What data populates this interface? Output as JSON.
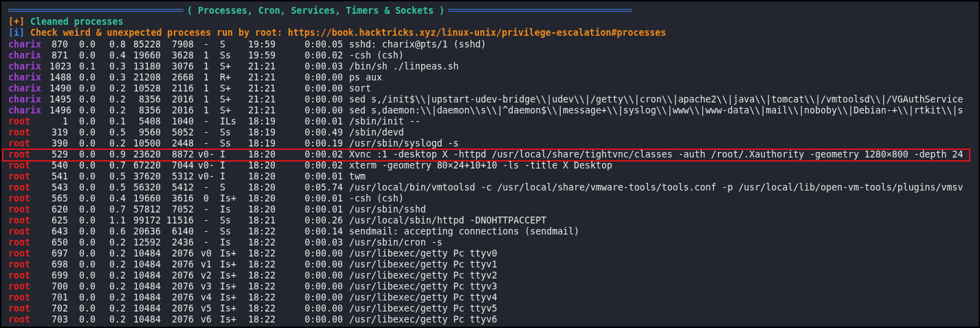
{
  "section_title": "( Processes, Cron, Services, Timers & Sockets )",
  "messages": [
    {
      "marker": "[+]",
      "kind": "ok",
      "text": "Cleaned processes"
    },
    {
      "marker": "[i]",
      "kind": "info",
      "text": "Check weird & unexpected proceses run by root: https://book.hacktricks.xyz/linux-unix/privilege-escalation#processes"
    }
  ],
  "rows": [
    {
      "user": "charix",
      "color": "#a244d4",
      "pid": "870",
      "cpu": "0.0",
      "mem": "0.8",
      "vsz": "85228",
      "rss": "7908",
      "tt": "-",
      "stat": "S",
      "started": "19:59",
      "time": "0:00.05",
      "command": "sshd: charix@pts/1 (sshd)",
      "highlighted": false
    },
    {
      "user": "charix",
      "color": "#a244d4",
      "pid": "871",
      "cpu": "0.0",
      "mem": "0.4",
      "vsz": "19660",
      "rss": "3628",
      "tt": "1",
      "stat": "Ss",
      "started": "19:59",
      "time": "0:00.02",
      "command": "-csh (csh)",
      "highlighted": false
    },
    {
      "user": "charix",
      "color": "#a244d4",
      "pid": "1023",
      "cpu": "0.1",
      "mem": "0.3",
      "vsz": "13180",
      "rss": "3076",
      "tt": "1",
      "stat": "S+",
      "started": "21:21",
      "time": "0:00.03",
      "command": "/bin/sh ./linpeas.sh",
      "highlighted": false
    },
    {
      "user": "charix",
      "color": "#a244d4",
      "pid": "1488",
      "cpu": "0.0",
      "mem": "0.3",
      "vsz": "21208",
      "rss": "2668",
      "tt": "1",
      "stat": "R+",
      "started": "21:21",
      "time": "0:00.00",
      "command": "ps aux",
      "highlighted": false
    },
    {
      "user": "charix",
      "color": "#a244d4",
      "pid": "1490",
      "cpu": "0.0",
      "mem": "0.2",
      "vsz": "10528",
      "rss": "2116",
      "tt": "1",
      "stat": "S+",
      "started": "21:21",
      "time": "0:00.00",
      "command": "sort",
      "highlighted": false
    },
    {
      "user": "charix",
      "color": "#a244d4",
      "pid": "1495",
      "cpu": "0.0",
      "mem": "0.2",
      "vsz": "8356",
      "rss": "2016",
      "tt": "1",
      "stat": "S+",
      "started": "21:21",
      "time": "0:00.00",
      "command": "sed s,/init$\\\\|upstart-udev-bridge\\\\|udev\\\\|/getty\\\\|cron\\\\|apache2\\\\|java\\\\|tomcat\\\\|/vmtoolsd\\\\|/VGAuthService",
      "highlighted": false
    },
    {
      "user": "charix",
      "color": "#a244d4",
      "pid": "1496",
      "cpu": "0.0",
      "mem": "0.2",
      "vsz": "8356",
      "rss": "2016",
      "tt": "1",
      "stat": "S+",
      "started": "21:21",
      "time": "0:00.00",
      "command": "sed s,daemon:\\\\|daemon\\\\s\\\\|^daemon$\\\\|message+\\\\|syslog\\\\|www\\\\|www-data\\\\|mail\\\\|noboby\\\\|Debian-+\\\\|rtkit\\\\|s",
      "highlighted": false
    },
    {
      "user": "root",
      "color": "#e8201e",
      "pid": "1",
      "cpu": "0.0",
      "mem": "0.1",
      "vsz": "5408",
      "rss": "1040",
      "tt": "-",
      "stat": "ILs",
      "started": "18:19",
      "time": "0:00.01",
      "command": "/sbin/init --",
      "highlighted": false
    },
    {
      "user": "root",
      "color": "#e8201e",
      "pid": "319",
      "cpu": "0.0",
      "mem": "0.5",
      "vsz": "9560",
      "rss": "5052",
      "tt": "-",
      "stat": "Ss",
      "started": "18:19",
      "time": "0:00.49",
      "command": "/sbin/devd",
      "highlighted": false
    },
    {
      "user": "root",
      "color": "#e8201e",
      "pid": "390",
      "cpu": "0.0",
      "mem": "0.2",
      "vsz": "10500",
      "rss": "2448",
      "tt": "-",
      "stat": "Ss",
      "started": "18:19",
      "time": "0:00.19",
      "command": "/usr/sbin/syslogd -s",
      "highlighted": false
    },
    {
      "user": "root",
      "color": "#e8201e",
      "pid": "529",
      "cpu": "0.0",
      "mem": "0.9",
      "vsz": "23620",
      "rss": "8872",
      "tt": "v0-",
      "stat": "I",
      "started": "18:20",
      "time": "0:00.02",
      "command": "Xvnc :1 -desktop X -httpd /usr/local/share/tightvnc/classes -auth /root/.Xauthority -geometry 1280×800 -depth 24",
      "highlighted": true
    },
    {
      "user": "root",
      "color": "#e8201e",
      "pid": "540",
      "cpu": "0.0",
      "mem": "0.7",
      "vsz": "67220",
      "rss": "7044",
      "tt": "v0-",
      "stat": "I",
      "started": "18:20",
      "time": "0:00.02",
      "command": "xterm -geometry 80×24+10+10 -ls -title X Desktop",
      "highlighted": false
    },
    {
      "user": "root",
      "color": "#e8201e",
      "pid": "541",
      "cpu": "0.0",
      "mem": "0.5",
      "vsz": "37620",
      "rss": "5312",
      "tt": "v0-",
      "stat": "I",
      "started": "18:20",
      "time": "0:00.01",
      "command": "twm",
      "highlighted": false
    },
    {
      "user": "root",
      "color": "#e8201e",
      "pid": "543",
      "cpu": "0.0",
      "mem": "0.5",
      "vsz": "56320",
      "rss": "5412",
      "tt": "-",
      "stat": "S",
      "started": "18:20",
      "time": "0:05.74",
      "command": "/usr/local/bin/vmtoolsd -c /usr/local/share/vmware-tools/tools.conf -p /usr/local/lib/open-vm-tools/plugins/vmsv",
      "highlighted": false
    },
    {
      "user": "root",
      "color": "#e8201e",
      "pid": "565",
      "cpu": "0.0",
      "mem": "0.4",
      "vsz": "19660",
      "rss": "3616",
      "tt": "0",
      "stat": "Is+",
      "started": "18:20",
      "time": "0:00.01",
      "command": "-csh (csh)",
      "highlighted": false
    },
    {
      "user": "root",
      "color": "#e8201e",
      "pid": "620",
      "cpu": "0.0",
      "mem": "0.7",
      "vsz": "57812",
      "rss": "7052",
      "tt": "-",
      "stat": "Is",
      "started": "18:20",
      "time": "0:00.01",
      "command": "/usr/sbin/sshd",
      "highlighted": false
    },
    {
      "user": "root",
      "color": "#e8201e",
      "pid": "625",
      "cpu": "0.0",
      "mem": "1.1",
      "vsz": "99172",
      "rss": "11516",
      "tt": "-",
      "stat": "Ss",
      "started": "18:21",
      "time": "0:00.26",
      "command": "/usr/local/sbin/httpd -DNOHTTPACCEPT",
      "highlighted": false
    },
    {
      "user": "root",
      "color": "#e8201e",
      "pid": "643",
      "cpu": "0.0",
      "mem": "0.6",
      "vsz": "20636",
      "rss": "6140",
      "tt": "-",
      "stat": "Ss",
      "started": "18:22",
      "time": "0:00.14",
      "command": "sendmail: accepting connections (sendmail)",
      "highlighted": false
    },
    {
      "user": "root",
      "color": "#e8201e",
      "pid": "650",
      "cpu": "0.0",
      "mem": "0.2",
      "vsz": "12592",
      "rss": "2436",
      "tt": "-",
      "stat": "Is",
      "started": "18:22",
      "time": "0:00.03",
      "command": "/usr/sbin/cron -s",
      "highlighted": false
    },
    {
      "user": "root",
      "color": "#e8201e",
      "pid": "697",
      "cpu": "0.0",
      "mem": "0.2",
      "vsz": "10484",
      "rss": "2076",
      "tt": "v0",
      "stat": "Is+",
      "started": "18:22",
      "time": "0:00.00",
      "command": "/usr/libexec/getty Pc ttyv0",
      "highlighted": false
    },
    {
      "user": "root",
      "color": "#e8201e",
      "pid": "698",
      "cpu": "0.0",
      "mem": "0.2",
      "vsz": "10484",
      "rss": "2076",
      "tt": "v1",
      "stat": "Is+",
      "started": "18:22",
      "time": "0:00.00",
      "command": "/usr/libexec/getty Pc ttyv1",
      "highlighted": false
    },
    {
      "user": "root",
      "color": "#e8201e",
      "pid": "699",
      "cpu": "0.0",
      "mem": "0.2",
      "vsz": "10484",
      "rss": "2076",
      "tt": "v2",
      "stat": "Is+",
      "started": "18:22",
      "time": "0:00.00",
      "command": "/usr/libexec/getty Pc ttyv2",
      "highlighted": false
    },
    {
      "user": "root",
      "color": "#e8201e",
      "pid": "700",
      "cpu": "0.0",
      "mem": "0.2",
      "vsz": "10484",
      "rss": "2076",
      "tt": "v3",
      "stat": "Is+",
      "started": "18:22",
      "time": "0:00.00",
      "command": "/usr/libexec/getty Pc ttyv3",
      "highlighted": false
    },
    {
      "user": "root",
      "color": "#e8201e",
      "pid": "701",
      "cpu": "0.0",
      "mem": "0.2",
      "vsz": "10484",
      "rss": "2076",
      "tt": "v4",
      "stat": "Is+",
      "started": "18:22",
      "time": "0:00.00",
      "command": "/usr/libexec/getty Pc ttyv4",
      "highlighted": false
    },
    {
      "user": "root",
      "color": "#e8201e",
      "pid": "702",
      "cpu": "0.0",
      "mem": "0.2",
      "vsz": "10484",
      "rss": "2076",
      "tt": "v5",
      "stat": "Is+",
      "started": "18:22",
      "time": "0:00.00",
      "command": "/usr/libexec/getty Pc ttyv5",
      "highlighted": false
    },
    {
      "user": "root",
      "color": "#e8201e",
      "pid": "703",
      "cpu": "0.0",
      "mem": "0.2",
      "vsz": "10484",
      "rss": "2076",
      "tt": "v6",
      "stat": "Is+",
      "started": "18:22",
      "time": "0:00.00",
      "command": "/usr/libexec/getty Pc ttyv6",
      "highlighted": false
    }
  ]
}
